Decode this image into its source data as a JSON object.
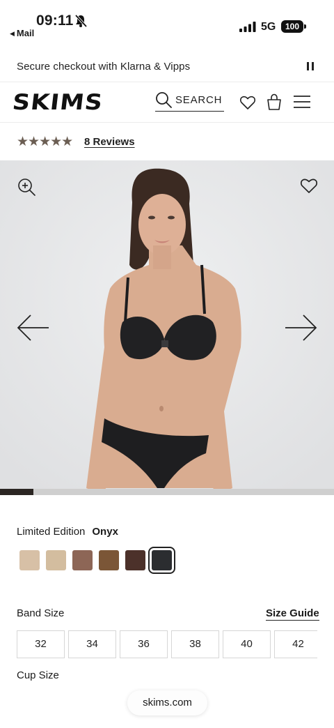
{
  "status_bar": {
    "time": "09:11",
    "back_app": "Mail",
    "network": "5G",
    "battery": "100"
  },
  "promo": {
    "text": "Secure checkout with Klarna & Vipps"
  },
  "header": {
    "logo": "SKIMS",
    "search_label": "SEARCH"
  },
  "reviews": {
    "stars": "★★★★★",
    "rating": 5,
    "link_text": "8 Reviews"
  },
  "gallery": {
    "progress_fraction": 0.1
  },
  "color": {
    "label": "Limited Edition",
    "selected_name": "Onyx",
    "swatches": [
      {
        "hex": "#d7c0a6"
      },
      {
        "hex": "#d3bd9f"
      },
      {
        "hex": "#8d6656"
      },
      {
        "hex": "#7b5637"
      },
      {
        "hex": "#4c312a"
      },
      {
        "hex": "#2b2d30",
        "selected": true
      }
    ]
  },
  "band": {
    "label": "Band Size",
    "guide_link": "Size Guide",
    "sizes": [
      "32",
      "34",
      "36",
      "38",
      "40",
      "42"
    ]
  },
  "cup": {
    "label": "Cup Size"
  },
  "browser": {
    "url": "skims.com"
  }
}
